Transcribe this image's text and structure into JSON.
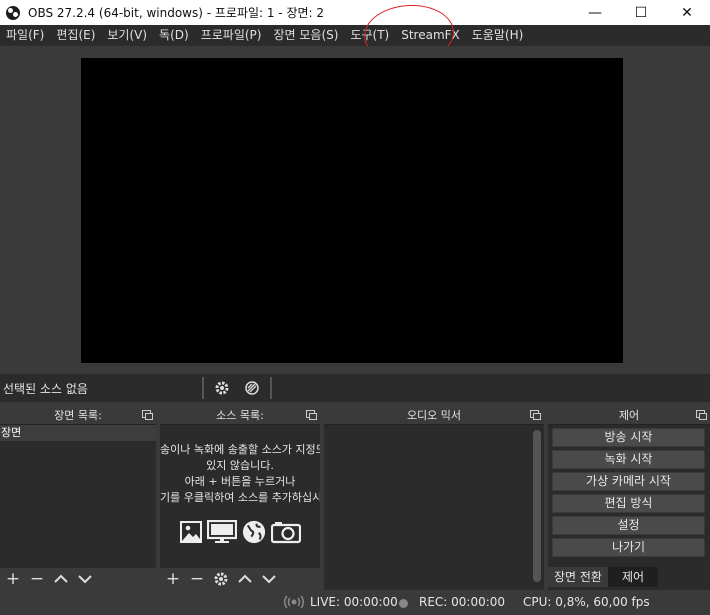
{
  "window": {
    "title": "OBS 27.2.4 (64-bit, windows) - 프로파일: 1 - 장면: 2",
    "minimize": "—",
    "maximize": "☐",
    "close": "✕"
  },
  "menu": {
    "items": [
      "파일(F)",
      "편집(E)",
      "보기(V)",
      "독(D)",
      "프로파일(P)",
      "장면 모음(S)",
      "도구(T)",
      "StreamFX",
      "도움말(H)"
    ]
  },
  "source_toolbar": {
    "no_source_label": "선택된 소스 없음",
    "icons": [
      "gear-icon",
      "filter-icon"
    ]
  },
  "scenes_dock": {
    "title": "장면 목록:",
    "items": [
      "장면"
    ]
  },
  "sources_dock": {
    "title": "소스 목록:",
    "empty_lines": [
      "송이나 녹화에 송출할 소스가 지정도",
      "있지 않습니다.",
      "아래 + 버튼을 누르거나",
      "기를 우클릭하여 소스를 추가하십시"
    ],
    "empty_icons": [
      "image-icon",
      "display-icon",
      "globe-icon",
      "camera-icon"
    ]
  },
  "mixer_dock": {
    "title": "오디오 믹서"
  },
  "controls_dock": {
    "title": "제어",
    "buttons": [
      "방송 시작",
      "녹화 시작",
      "가상 카메라 시작",
      "편집 방식",
      "설정",
      "나가기"
    ],
    "tabs": [
      "장면 전환",
      "제어"
    ],
    "active_tab": "제어"
  },
  "status": {
    "live": "LIVE: 00:00:00",
    "rec": "REC: 00:00:00",
    "cpu": "CPU: 0,8%, 60,00 fps"
  },
  "colors": {
    "annotation": "#d22222",
    "background": "#3a3a3a",
    "panel": "#2b2b2b"
  }
}
